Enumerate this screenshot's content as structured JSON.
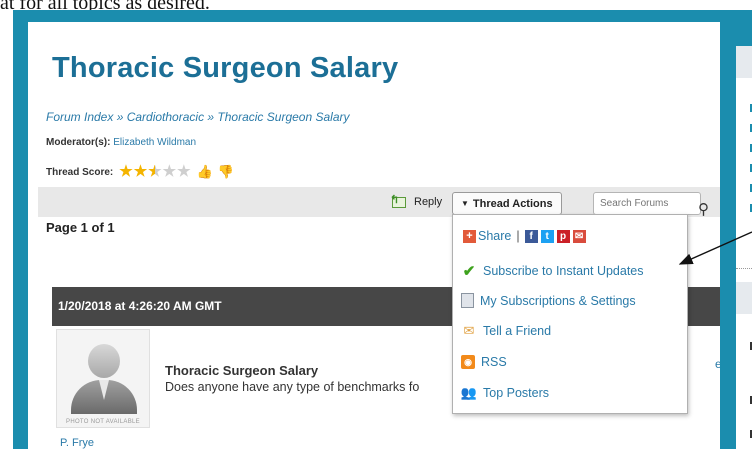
{
  "caption": "at for all topics as desired.",
  "page": {
    "title": "Thoracic Surgeon Salary",
    "breadcrumb": {
      "forum_index": "Forum Index",
      "sep": " » ",
      "category": "Cardiothoracic",
      "current": "Thoracic Surgeon Salary"
    },
    "moderator_label": "Moderator(s):",
    "moderator_name": "Elizabeth Wildman",
    "thread_score_label": "Thread Score:",
    "thread_score": 2.5,
    "thread_score_max": 5
  },
  "toolbar": {
    "reply_label": "Reply",
    "thread_actions_label": "Thread Actions",
    "search_placeholder": "Search Forums"
  },
  "paging": {
    "label": "Page 1 of 1"
  },
  "dropdown": {
    "share_label": "Share",
    "share_sep": "|",
    "subscribe": "Subscribe to Instant Updates",
    "subscriptions": "My Subscriptions & Settings",
    "tell_friend": "Tell a Friend",
    "rss": "RSS",
    "top_posters": "Top Posters"
  },
  "post": {
    "timestamp": "1/20/2018 at 4:26:20 AM GMT",
    "avatar_caption": "PHOTO NOT AVAILABLE",
    "title": "Thoracic Surgeon Salary",
    "text": "Does anyone have any type of benchmarks fo",
    "side_link": "e",
    "author": "P. Frye"
  },
  "colors": {
    "brand_blue": "#1b8dae",
    "title_blue": "#1c6f96",
    "link_blue": "#2a7aa8",
    "post_header_bg": "#474747"
  }
}
